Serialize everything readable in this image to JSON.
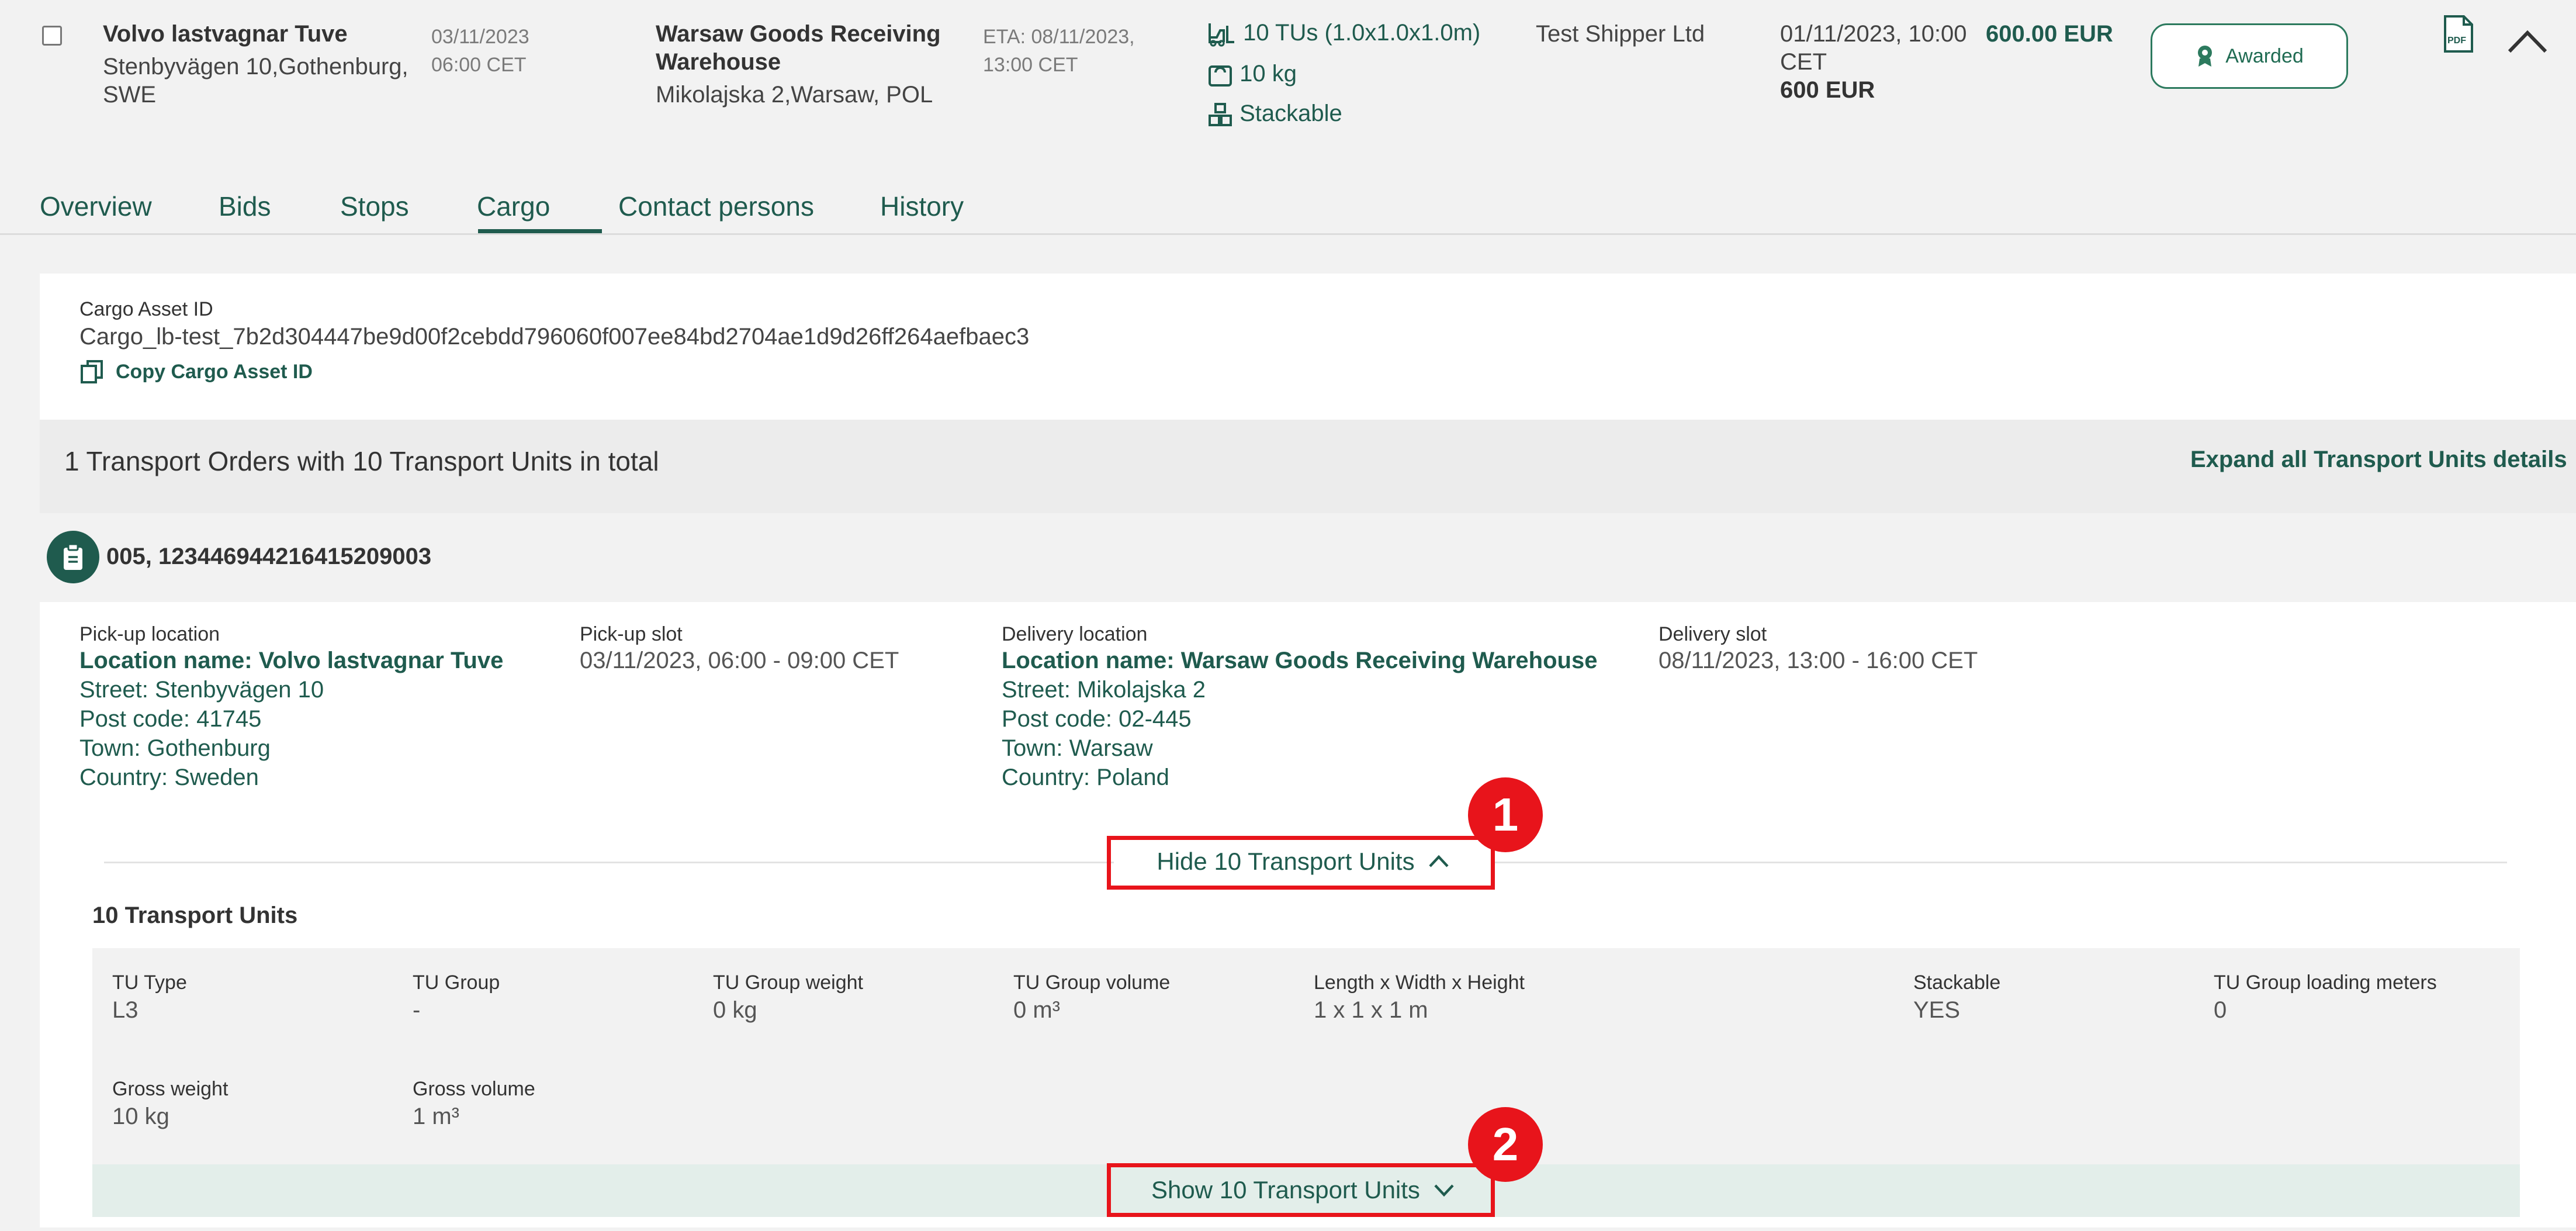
{
  "row": {
    "origin_name": "Volvo lastvagnar Tuve",
    "origin_addr_1": "Stenbyvägen 10,Gothenburg,",
    "origin_addr_2": "SWE",
    "pickup_date": "03/11/2023",
    "pickup_time": "06:00 CET",
    "dest_name_1": "Warsaw Goods Receiving",
    "dest_name_2": "Warehouse",
    "dest_addr": "Mikolajska 2,Warsaw, POL",
    "eta_1": "ETA:  08/11/2023,",
    "eta_2": "13:00 CET",
    "tus": "10 TUs (1.0x1.0x1.0m)",
    "weight": "10 kg",
    "stackable": "Stackable",
    "shipper": "Test Shipper Ltd",
    "bid_date_1": "01/11/2023, 10:00",
    "bid_date_2": "CET",
    "price": "600.00 EUR",
    "price_2": "600 EUR",
    "status": "Awarded"
  },
  "tabs": [
    "Overview",
    "Bids",
    "Stops",
    "Cargo",
    "Contact persons",
    "History"
  ],
  "asset": {
    "label": "Cargo Asset ID",
    "value": "Cargo_lb-test_7b2d304447be9d00f2cebdd796060f007ee84bd2704ae1d9d26ff264aefbaec3",
    "copy_label": "Copy Cargo Asset ID"
  },
  "summary": {
    "text": "1 Transport Orders with 10 Transport Units in total",
    "expand_label": "Expand all Transport Units details"
  },
  "order": {
    "id": "005, 123446944216415209003"
  },
  "pickup": {
    "label": "Pick-up location",
    "name": "Location name: Volvo lastvagnar Tuve",
    "street": "Street: Stenbyvägen 10",
    "post": "Post code: 41745",
    "town": "Town: Gothenburg",
    "country": "Country: Sweden"
  },
  "pickup_slot": {
    "label": "Pick-up slot",
    "value": "03/11/2023, 06:00 - 09:00 CET"
  },
  "delivery": {
    "label": "Delivery location",
    "name": "Location name: Warsaw Goods Receiving Warehouse",
    "street": "Street: Mikolajska 2",
    "post": "Post code: 02-445",
    "town": "Town: Warsaw",
    "country": "Country: Poland"
  },
  "delivery_slot": {
    "label": "Delivery slot",
    "value": "08/11/2023, 13:00 - 16:00 CET"
  },
  "hide_tu_label": "Hide 10 Transport Units",
  "tu_section_title": "10 Transport Units",
  "tu": {
    "type_label": "TU Type",
    "type_value": "L3",
    "group_label": "TU Group",
    "group_value": "-",
    "gweight_label": "TU Group weight",
    "gweight_value": "0 kg",
    "gvolume_label": "TU Group volume",
    "gvolume_value": "0 m³",
    "dims_label": "Length x Width x Height",
    "dims_value": "1 x 1 x 1 m",
    "stack_label": "Stackable",
    "stack_value": "YES",
    "ldm_label": "TU Group loading meters",
    "ldm_value": "0",
    "gross_w_label": "Gross weight",
    "gross_w_value": "10 kg",
    "gross_v_label": "Gross volume",
    "gross_v_value": "1 m³"
  },
  "show_tu_label": "Show 10 Transport Units",
  "markers": [
    "1",
    "2"
  ],
  "colors": {
    "accent": "#1f5b4e",
    "highlight": "#e8141b",
    "awarded": "#2c7a5e"
  }
}
